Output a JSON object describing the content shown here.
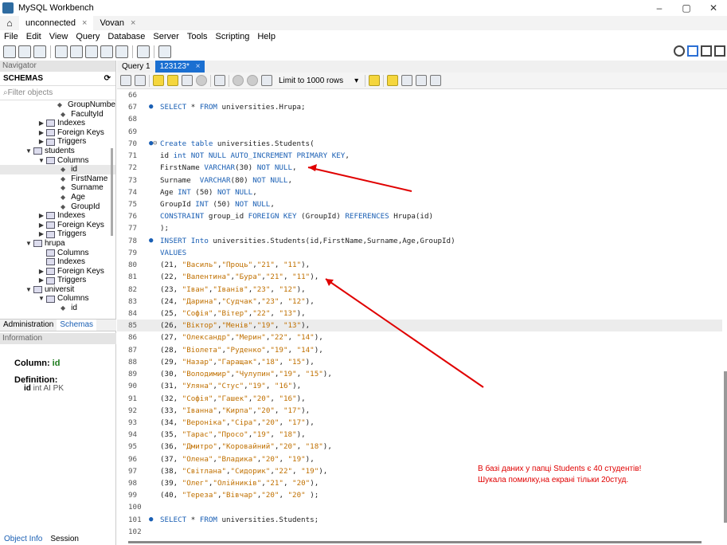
{
  "window": {
    "title": "MySQL Workbench",
    "controls": [
      "–",
      "▢",
      "✕"
    ]
  },
  "tabs": [
    {
      "label": "unconnected",
      "close": "×"
    },
    {
      "label": "Vovan",
      "close": "×"
    }
  ],
  "menu": [
    "File",
    "Edit",
    "View",
    "Query",
    "Database",
    "Server",
    "Tools",
    "Scripting",
    "Help"
  ],
  "navigator": {
    "header": "Navigator",
    "schemas_label": "SCHEMAS",
    "filter_placeholder": "Filter objects",
    "tree": [
      {
        "indent": 3,
        "icon": "diamond",
        "label": "GroupNumbe"
      },
      {
        "indent": 3,
        "icon": "diamond",
        "label": "FacultyId"
      },
      {
        "indent": 2,
        "icon": "table",
        "toggle": "▶",
        "label": "Indexes"
      },
      {
        "indent": 2,
        "icon": "table",
        "toggle": "▶",
        "label": "Foreign Keys"
      },
      {
        "indent": 2,
        "icon": "table",
        "toggle": "▶",
        "label": "Triggers"
      },
      {
        "indent": 1,
        "icon": "table",
        "toggle": "▼",
        "label": "students"
      },
      {
        "indent": 2,
        "icon": "table",
        "toggle": "▼",
        "label": "Columns"
      },
      {
        "indent": 3,
        "icon": "diamond",
        "label": "id",
        "selected": true
      },
      {
        "indent": 3,
        "icon": "diamond",
        "label": "FirstName"
      },
      {
        "indent": 3,
        "icon": "diamond",
        "label": "Surname"
      },
      {
        "indent": 3,
        "icon": "diamond",
        "label": "Age"
      },
      {
        "indent": 3,
        "icon": "diamond",
        "label": "GroupId"
      },
      {
        "indent": 2,
        "icon": "table",
        "toggle": "▶",
        "label": "Indexes"
      },
      {
        "indent": 2,
        "icon": "table",
        "toggle": "▶",
        "label": "Foreign Keys"
      },
      {
        "indent": 2,
        "icon": "table",
        "toggle": "▶",
        "label": "Triggers"
      },
      {
        "indent": 1,
        "icon": "table",
        "toggle": "▼",
        "label": "hrupa"
      },
      {
        "indent": 2,
        "icon": "table",
        "label": "Columns"
      },
      {
        "indent": 2,
        "icon": "table",
        "label": "Indexes"
      },
      {
        "indent": 2,
        "icon": "table",
        "toggle": "▶",
        "label": "Foreign Keys"
      },
      {
        "indent": 2,
        "icon": "table",
        "toggle": "▶",
        "label": "Triggers"
      },
      {
        "indent": 1,
        "icon": "table",
        "toggle": "▼",
        "label": "universit"
      },
      {
        "indent": 2,
        "icon": "table",
        "toggle": "▼",
        "label": "Columns"
      },
      {
        "indent": 3,
        "icon": "diamond",
        "label": "id"
      }
    ]
  },
  "admin_tabs": [
    "Administration",
    "Schemas"
  ],
  "information": {
    "header": "Information",
    "column_label": "Column:",
    "column_value": "id",
    "definition_label": "Definition:",
    "def_name": "id",
    "def_type": "int AI PK"
  },
  "bottom_tabs": [
    "Object Info",
    "Session"
  ],
  "query_tabs": [
    {
      "label": "Query 1"
    },
    {
      "label": "123123*",
      "close": "×"
    }
  ],
  "limit_label": "Limit to 1000 rows",
  "code_lines": [
    {
      "n": "66",
      "text": ""
    },
    {
      "n": "67",
      "dot": true,
      "html": "<span class='kw'>SELECT</span> * <span class='kw'>FROM</span> universities.Hrupa;"
    },
    {
      "n": "68",
      "text": ""
    },
    {
      "n": "69",
      "text": ""
    },
    {
      "n": "70",
      "dot": true,
      "fold": true,
      "html": "<span class='kw'>Create table</span> universities.Students("
    },
    {
      "n": "71",
      "html": "id <span class='kw'>int NOT NULL AUTO_INCREMENT PRIMARY KEY</span>,"
    },
    {
      "n": "72",
      "html": "FirstName <span class='kw'>VARCHAR</span>(30) <span class='kw'>NOT NULL</span>,"
    },
    {
      "n": "73",
      "html": "Surname  <span class='kw'>VARCHAR</span>(80) <span class='kw'>NOT NULL</span>,"
    },
    {
      "n": "74",
      "html": "Age <span class='kw'>INT</span> (50) <span class='kw'>NOT NULL</span>,"
    },
    {
      "n": "75",
      "html": "GroupId <span class='kw'>INT</span> (50) <span class='kw'>NOT NULL</span>,"
    },
    {
      "n": "76",
      "html": "<span class='kw'>CONSTRAINT</span> group_id <span class='kw'>FOREIGN KEY</span> (GroupId) <span class='kw'>REFERENCES</span> Hrupa(id)"
    },
    {
      "n": "77",
      "html": ");"
    },
    {
      "n": "78",
      "dot": true,
      "html": "<span class='kw'>INSERT Into</span> universities.Students(id,FirstName,Surname,Age,GroupId)"
    },
    {
      "n": "79",
      "html": "<span class='kw'>VALUES</span>"
    },
    {
      "n": "80",
      "html": "(21, <span class='str'>\"Василь\"</span>,<span class='str'>\"Проць\"</span>,<span class='str'>\"21\"</span>, <span class='str'>\"11\"</span>),"
    },
    {
      "n": "81",
      "html": "(22, <span class='str'>\"Валентина\"</span>,<span class='str'>\"Бура\"</span>,<span class='str'>\"21\"</span>, <span class='str'>\"11\"</span>),"
    },
    {
      "n": "82",
      "html": "(23, <span class='str'>\"Іван\"</span>,<span class='str'>\"Іванів\"</span>,<span class='str'>\"23\"</span>, <span class='str'>\"12\"</span>),"
    },
    {
      "n": "83",
      "html": "(24, <span class='str'>\"Дарина\"</span>,<span class='str'>\"Судчак\"</span>,<span class='str'>\"23\"</span>, <span class='str'>\"12\"</span>),"
    },
    {
      "n": "84",
      "html": "(25, <span class='str'>\"Софія\"</span>,<span class='str'>\"Вітер\"</span>,<span class='str'>\"22\"</span>, <span class='str'>\"13\"</span>),"
    },
    {
      "n": "85",
      "hl": true,
      "html": "(26, <span class='str'>\"Віктор\"</span>,<span class='str'>\"Менів\"</span>,<span class='str'>\"19\"</span>, <span class='str'>\"13\"</span>),"
    },
    {
      "n": "86",
      "html": "(27, <span class='str'>\"Олександр\"</span>,<span class='str'>\"Мерин\"</span>,<span class='str'>\"22\"</span>, <span class='str'>\"14\"</span>),"
    },
    {
      "n": "87",
      "html": "(28, <span class='str'>\"Віолета\"</span>,<span class='str'>\"Руденко\"</span>,<span class='str'>\"19\"</span>, <span class='str'>\"14\"</span>),"
    },
    {
      "n": "88",
      "html": "(29, <span class='str'>\"Назар\"</span>,<span class='str'>\"Гаращак\"</span>,<span class='str'>\"18\"</span>, <span class='str'>\"15\"</span>),"
    },
    {
      "n": "89",
      "html": "(30, <span class='str'>\"Володимир\"</span>,<span class='str'>\"Чулупин\"</span>,<span class='str'>\"19\"</span>, <span class='str'>\"15\"</span>),"
    },
    {
      "n": "90",
      "html": "(31, <span class='str'>\"Уляна\"</span>,<span class='str'>\"Стус\"</span>,<span class='str'>\"19\"</span>, <span class='str'>\"16\"</span>),"
    },
    {
      "n": "91",
      "html": "(32, <span class='str'>\"Софія\"</span>,<span class='str'>\"Гашек\"</span>,<span class='str'>\"20\"</span>, <span class='str'>\"16\"</span>),"
    },
    {
      "n": "92",
      "html": "(33, <span class='str'>\"Іванна\"</span>,<span class='str'>\"Кирпа\"</span>,<span class='str'>\"20\"</span>, <span class='str'>\"17\"</span>),"
    },
    {
      "n": "93",
      "html": "(34, <span class='str'>\"Вероніка\"</span>,<span class='str'>\"Сіра\"</span>,<span class='str'>\"20\"</span>, <span class='str'>\"17\"</span>),"
    },
    {
      "n": "94",
      "html": "(35, <span class='str'>\"Тарас\"</span>,<span class='str'>\"Просо\"</span>,<span class='str'>\"19\"</span>, <span class='str'>\"18\"</span>),"
    },
    {
      "n": "95",
      "html": "(36, <span class='str'>\"Дмитро\"</span>,<span class='str'>\"Коровайний\"</span>,<span class='str'>\"20\"</span>, <span class='str'>\"18\"</span>),"
    },
    {
      "n": "96",
      "html": "(37, <span class='str'>\"Олена\"</span>,<span class='str'>\"Владика\"</span>,<span class='str'>\"20\"</span>, <span class='str'>\"19\"</span>),"
    },
    {
      "n": "97",
      "html": "(38, <span class='str'>\"Світлана\"</span>,<span class='str'>\"Сидорик\"</span>,<span class='str'>\"22\"</span>, <span class='str'>\"19\"</span>),"
    },
    {
      "n": "98",
      "html": "(39, <span class='str'>\"Олег\"</span>,<span class='str'>\"Олійників\"</span>,<span class='str'>\"21\"</span>, <span class='str'>\"20\"</span>),"
    },
    {
      "n": "99",
      "html": "(40, <span class='str'>\"Тереза\"</span>,<span class='str'>\"Вівчар\"</span>,<span class='str'>\"20\"</span>, <span class='str'>\"20\"</span> );"
    },
    {
      "n": "100",
      "text": ""
    },
    {
      "n": "101",
      "dot": true,
      "html": "<span class='kw'>SELECT</span> * <span class='kw'>FROM</span> universities.Students;"
    },
    {
      "n": "102",
      "text": ""
    }
  ],
  "annotation": {
    "line1": "В базі даних у папці Students є 40 студентів!",
    "line2": "Шукала помилку,на екрані тільки 20студ.",
    "color": "#e00000"
  }
}
